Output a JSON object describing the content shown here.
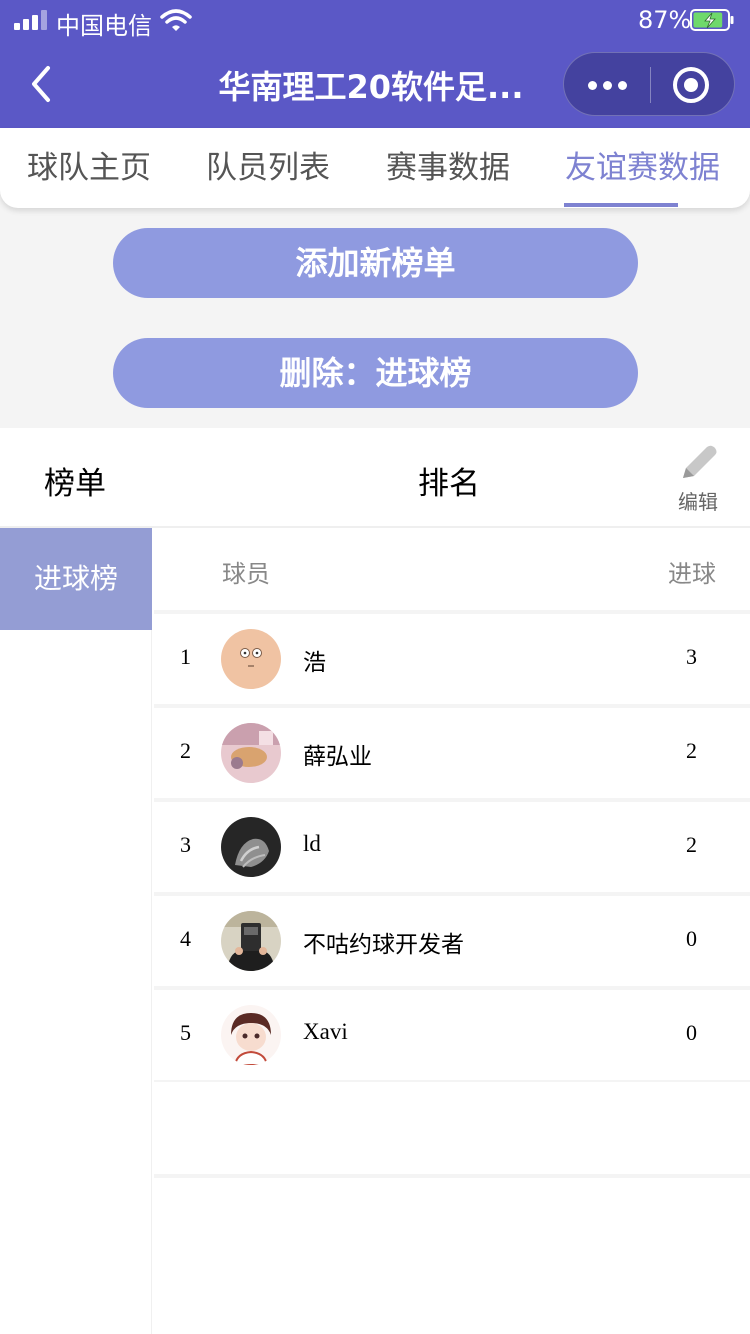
{
  "status_bar": {
    "carrier": "中国电信",
    "battery_percent": "87%",
    "battery_level": 0.87
  },
  "nav": {
    "title": "华南理工20软件足..."
  },
  "tabs": [
    {
      "label": "球队主页",
      "active": false
    },
    {
      "label": "队员列表",
      "active": false
    },
    {
      "label": "赛事数据",
      "active": false
    },
    {
      "label": "友谊赛数据",
      "active": true
    }
  ],
  "buttons": {
    "add_board": "添加新榜单",
    "delete_board": "删除：进球榜"
  },
  "ranking": {
    "left_header": "榜单",
    "center_header": "排名",
    "edit_label": "编辑"
  },
  "sidebar": {
    "items": [
      {
        "label": "进球榜",
        "selected": true
      }
    ]
  },
  "table": {
    "columns": {
      "player": "球员",
      "goals": "进球"
    },
    "rows": [
      {
        "rank": "1",
        "name": "浩",
        "goals": "3"
      },
      {
        "rank": "2",
        "name": "薛弘业",
        "goals": "2"
      },
      {
        "rank": "3",
        "name": "ld",
        "goals": "2"
      },
      {
        "rank": "4",
        "name": "不咕约球开发者",
        "goals": "0"
      },
      {
        "rank": "5",
        "name": "Xavi",
        "goals": "0"
      }
    ]
  },
  "colors": {
    "header": "#5b58c6",
    "accent": "#7e82d1",
    "button": "#8f9ae0",
    "sidebar_selected": "#949dd4"
  }
}
